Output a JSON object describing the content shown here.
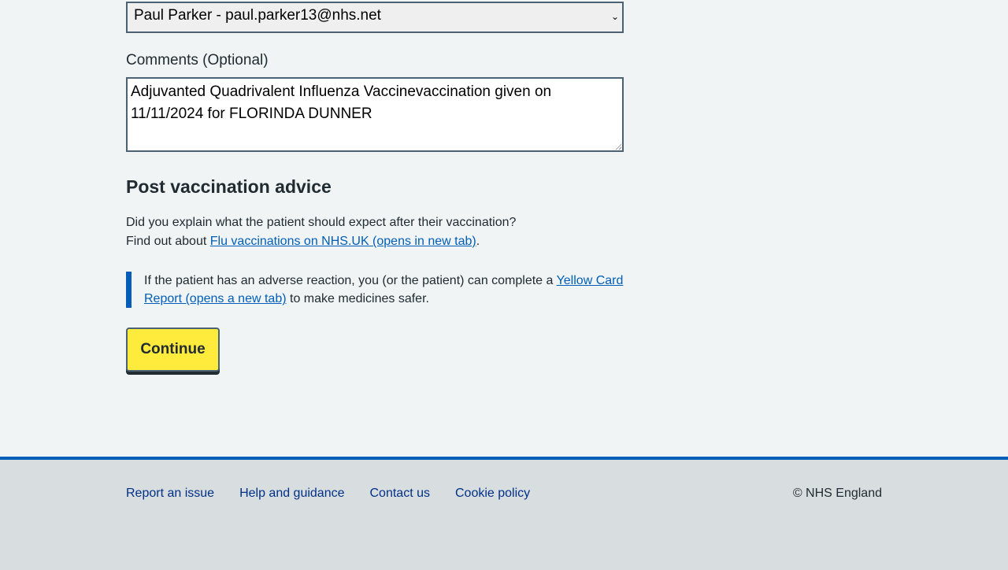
{
  "form": {
    "vaccinator_select": {
      "selected": "Paul Parker - paul.parker13@nhs.net"
    },
    "comments_label": "Comments (Optional)",
    "comments_value": "Adjuvanted Quadrivalent Influenza Vaccinevaccination given on 11/11/2024 for FLORINDA DUNNER"
  },
  "advice": {
    "heading": "Post vaccination advice",
    "question": "Did you explain what the patient should expect after their vaccination?",
    "find_out_prefix": "Find out about ",
    "find_out_link": "Flu vaccinations on NHS.UK (opens in new tab)",
    "find_out_suffix": ".",
    "inset_prefix": "If the patient has an adverse reaction, you (or the patient) can complete a ",
    "inset_link": "Yellow Card Report (opens a new tab)",
    "inset_suffix": " to make medicines safer."
  },
  "continue_label": "Continue",
  "footer": {
    "links": [
      "Report an issue",
      "Help and guidance",
      "Contact us",
      "Cookie policy"
    ],
    "copyright": "© NHS England"
  },
  "colors": {
    "accent": "#005eb8",
    "button": "#ffeb3b",
    "footer_bg": "#d8dde0"
  }
}
